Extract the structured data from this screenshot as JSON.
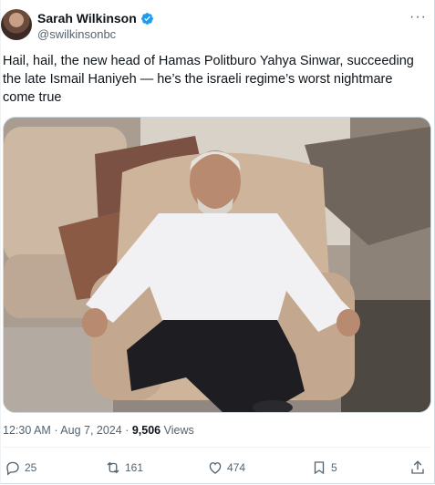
{
  "author": {
    "display_name": "Sarah Wilkinson",
    "handle": "@swilkinsonbc",
    "verified": true,
    "verified_color": "#1d9bf0"
  },
  "more_icon": "more-dots-icon",
  "tweet": {
    "text": "Hail, hail, the new head of Hamas Politburo Yahya Sinwar, succeeding the late Ismail Haniyeh — he’s the israeli regime’s worst nightmare come true"
  },
  "meta": {
    "time": "12:30 AM",
    "separator": "·",
    "date": "Aug 7, 2024",
    "views_count": "9,506",
    "views_label": "Views"
  },
  "actions": {
    "replies": "25",
    "reposts": "161",
    "likes": "474",
    "bookmarks": "5"
  },
  "icons": {
    "reply": "reply-icon",
    "repost": "repost-icon",
    "like": "heart-icon",
    "bookmark": "bookmark-icon",
    "share": "share-icon"
  }
}
